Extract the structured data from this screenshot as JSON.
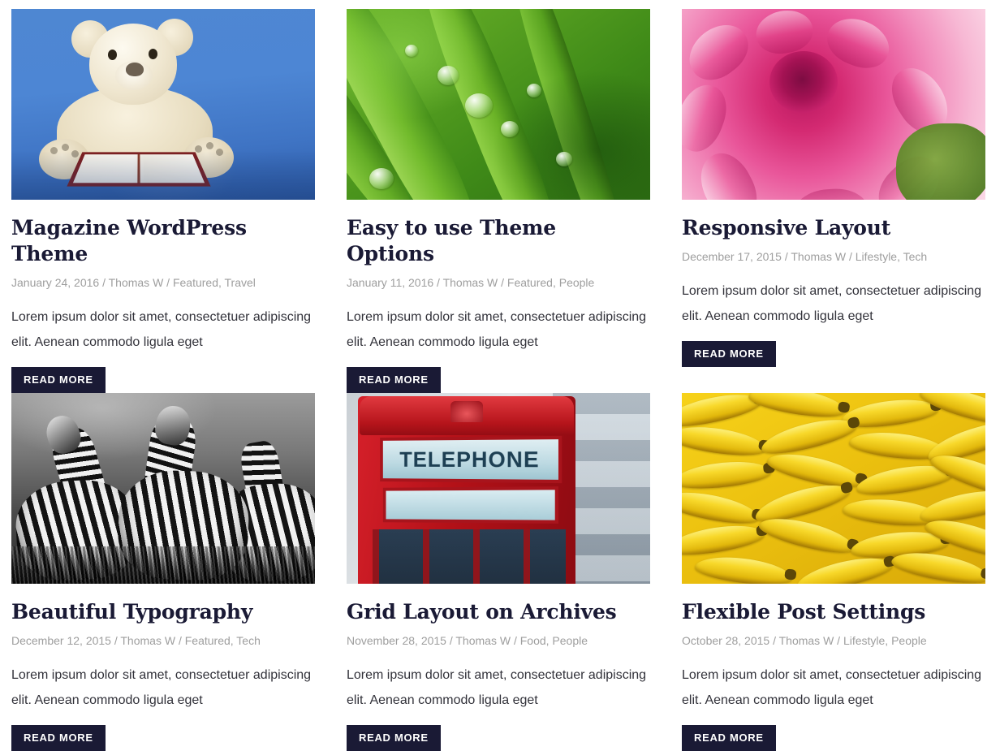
{
  "grid": {
    "columns": 3,
    "accent_color": "#1a1a35",
    "meta_color": "#9e9e9e",
    "body_color": "#32323a",
    "read_more_label": "READ MORE",
    "posts": [
      {
        "id": "magazine-wordpress-theme",
        "title": "Magazine WordPress Theme",
        "date": "January 24, 2016",
        "author": "Thomas W",
        "categories": "Featured, Travel",
        "meta": "January 24, 2016 / Thomas W / Featured, Travel",
        "excerpt": "Lorem ipsum dolor sit amet, consectetuer adipiscing elit. Aenean commodo ligula eget",
        "read_more": "READ MORE",
        "image_alt": "white teddy bear reading a book on a blue blanket"
      },
      {
        "id": "easy-to-use-theme-options",
        "title": "Easy to use Theme Options",
        "date": "January 11, 2016",
        "author": "Thomas W",
        "categories": "Featured, People",
        "meta": "January 11, 2016 / Thomas W / Featured, People",
        "excerpt": "Lorem ipsum dolor sit amet, consectetuer adipiscing elit. Aenean commodo ligula eget",
        "read_more": "READ MORE",
        "image_alt": "green grass blades with water droplets"
      },
      {
        "id": "responsive-layout",
        "title": "Responsive Layout",
        "date": "December 17, 2015",
        "author": "Thomas W",
        "categories": "Lifestyle, Tech",
        "meta": "December 17, 2015 / Thomas W / Lifestyle, Tech",
        "excerpt": "Lorem ipsum dolor sit amet, consectetuer adipiscing elit. Aenean commodo ligula eget",
        "read_more": "READ MORE",
        "image_alt": "close-up of a pink dahlia flower"
      },
      {
        "id": "beautiful-typography",
        "title": "Beautiful Typography",
        "date": "December 12, 2015",
        "author": "Thomas W",
        "categories": "Featured, Tech",
        "meta": "December 12, 2015 / Thomas W / Featured, Tech",
        "excerpt": "Lorem ipsum dolor sit amet, consectetuer adipiscing elit. Aenean commodo ligula eget",
        "read_more": "READ MORE",
        "image_alt": "black and white photo of three zebras"
      },
      {
        "id": "grid-layout-on-archives",
        "title": "Grid Layout on Archives",
        "date": "November 28, 2015",
        "author": "Thomas W",
        "categories": "Food, People",
        "meta": "November 28, 2015 / Thomas W / Food, People",
        "excerpt": "Lorem ipsum dolor sit amet, consectetuer adipiscing elit. Aenean commodo ligula eget",
        "read_more": "READ MORE",
        "image_alt": "red British telephone box",
        "image_sign_text": "TELEPHONE"
      },
      {
        "id": "flexible-post-settings",
        "title": "Flexible Post Settings",
        "date": "October 28, 2015",
        "author": "Thomas W",
        "categories": "Lifestyle, People",
        "meta": "October 28, 2015 / Thomas W / Lifestyle, People",
        "excerpt": "Lorem ipsum dolor sit amet, consectetuer adipiscing elit. Aenean commodo ligula eget",
        "read_more": "READ MORE",
        "image_alt": "pile of yellow bananas"
      }
    ]
  }
}
